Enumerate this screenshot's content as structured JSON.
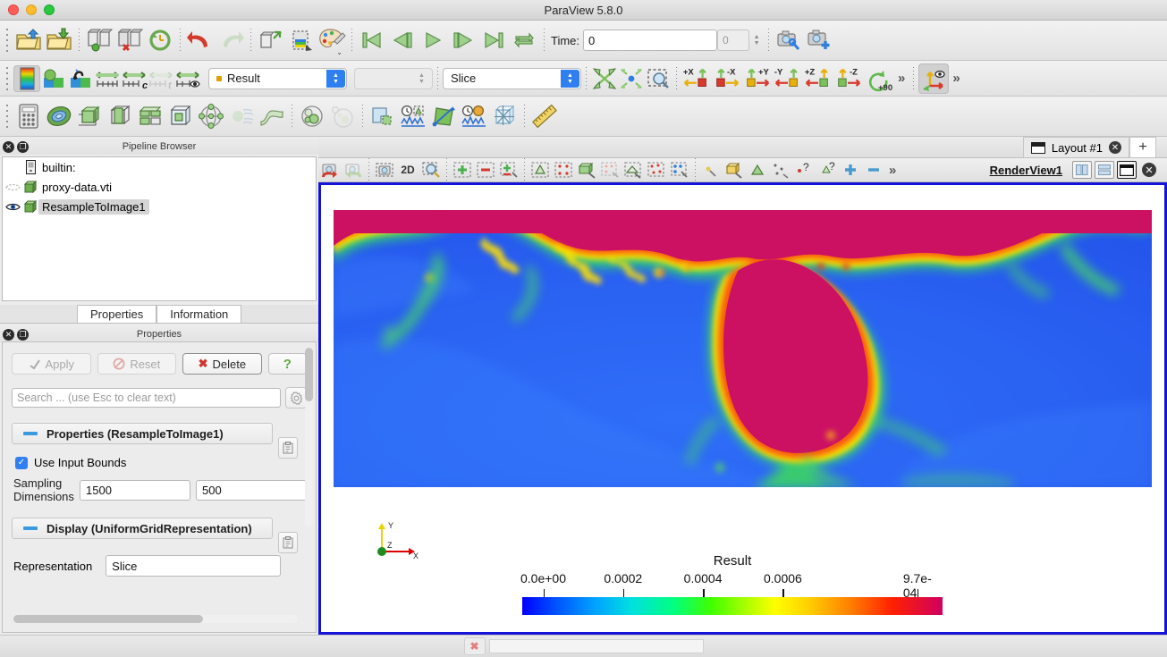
{
  "window": {
    "title": "ParaView 5.8.0",
    "traffic_lights": [
      "close-red",
      "minimize-yellow",
      "maximize-green"
    ]
  },
  "toolbars": {
    "row1": {
      "icons": [
        "open-file-icon",
        "save-state-icon",
        "connect-server-icon",
        "disconnect-server-icon",
        "reset-session-icon",
        "undo-icon",
        "redo-icon",
        "load-data-icon",
        "save-data-icon",
        "color-palette-icon"
      ],
      "vcr": [
        "first-frame-icon",
        "previous-frame-icon",
        "play-icon",
        "next-frame-icon",
        "last-frame-icon",
        "loop-icon"
      ],
      "time_label": "Time:",
      "time_value": "0",
      "frame_value": "0",
      "camera_icons": [
        "camera-link-icon",
        "camera-add-icon"
      ]
    },
    "row2": {
      "repr_icons": [
        "colormap-icon",
        "rescale-data-range-icon",
        "rescale-custom-icon",
        "rescale-visible-icon",
        "rescale-over-time-icon",
        "rescale-temporal-icon",
        "edit-color-legend-icon"
      ],
      "array_combo": "Result",
      "component_combo": "",
      "representation_combo": "Slice",
      "camera_buttons": [
        "reset-camera-icon",
        "zoom-to-data-icon",
        "zoom-to-box-icon"
      ],
      "axis_buttons": [
        "+X",
        "-X",
        "+Y",
        "-Y",
        "+Z",
        "-Z"
      ],
      "rotate_label": "+90",
      "overflow": "»",
      "center_axes_icon": "show-center-axes-icon"
    },
    "row3": {
      "icons": [
        "calculator-icon",
        "contour-icon",
        "clip-icon",
        "slice-icon",
        "threshold-icon",
        "extract-subset-icon",
        "glyph-icon",
        "stream-tracer-icon",
        "warp-icon",
        "group-datasets-icon",
        "extract-level-icon",
        "extract-block-icon",
        "plot-over-time-icon",
        "plot-over-line-icon",
        "probe-location-icon",
        "axes-grid-icon",
        "ruler-icon"
      ]
    }
  },
  "pipeline": {
    "panel_title": "Pipeline Browser",
    "items": [
      {
        "label": "builtin:",
        "icon": "server-icon",
        "eye": "none",
        "selected": false
      },
      {
        "label": "proxy-data.vti",
        "icon": "dataset-icon",
        "eye": "hidden",
        "selected": false
      },
      {
        "label": "ResampleToImage1",
        "icon": "dataset-icon",
        "eye": "visible",
        "selected": true
      }
    ]
  },
  "properties": {
    "tabs": [
      {
        "label": "Properties",
        "selected": true
      },
      {
        "label": "Information",
        "selected": false
      }
    ],
    "panel_title": "Properties",
    "buttons": [
      {
        "label": "Apply",
        "icon": "apply-icon",
        "enabled": false
      },
      {
        "label": "Reset",
        "icon": "reset-icon",
        "enabled": false
      },
      {
        "label": "Delete",
        "icon": "delete-icon",
        "enabled": true
      },
      {
        "label": "?",
        "icon": "help-icon",
        "enabled": true
      }
    ],
    "search_placeholder": "Search ... (use Esc to clear text)",
    "search_value": "",
    "gear_icon": "gear-icon",
    "sections": [
      {
        "title": "Properties (ResampleToImage1)",
        "collapse_icon": "collapse-minus-icon"
      },
      {
        "title": "Display (UniformGridRepresentation)",
        "collapse_icon": "collapse-minus-icon"
      }
    ],
    "use_input_bounds": {
      "label": "Use Input Bounds",
      "checked": true
    },
    "sampling": {
      "label_line1": "Sampling",
      "label_line2": "Dimensions",
      "values": [
        "1500",
        "500",
        ""
      ]
    },
    "representation": {
      "label": "Representation",
      "value": "Slice"
    }
  },
  "layout": {
    "tab_label": "Layout #1",
    "tab_icon": "layout-icon",
    "close_icon": "close-icon",
    "add_tab": "+"
  },
  "view": {
    "name": "RenderView1",
    "toolbar_icons": [
      "undo-camera-icon",
      "redo-camera-icon",
      "screenshot-icon",
      "2D",
      "zoom-select-icon",
      "add-selection-icon",
      "subtract-selection-icon",
      "toggle-selection-icon",
      "select-cells-icon",
      "select-points-icon",
      "select-surface-cells-icon",
      "select-surface-points-icon",
      "frustum-cells-icon",
      "frustum-points-icon",
      "block-select-icon",
      "interactive-select-points-icon",
      "hover-cells-icon",
      "hover-points-icon",
      "select-query-icon",
      "plus-icon",
      "minus-icon"
    ],
    "mode_2d_label": "2D",
    "split_buttons": [
      "split-horizontal-icon",
      "split-vertical-icon",
      "maximize-icon",
      "close-view-icon"
    ],
    "overflow": "»"
  },
  "legend": {
    "title": "Result",
    "tick_labels": [
      "0.0e+00",
      "0.0002",
      "0.0004",
      "0.0006",
      "9.7e-04"
    ],
    "tick_positions_pct": [
      5,
      24,
      43,
      62,
      94
    ],
    "mark_positions_pct": [
      5,
      24,
      43,
      62,
      94
    ],
    "colormap": "rainbow-jet"
  },
  "axes_widget": {
    "x_label": "X",
    "x_color": "#dd0000",
    "y_label": "Y",
    "y_color": "#e8d400",
    "z_label": "Z",
    "z_color": "#1f8b1f"
  },
  "statusbar": {
    "stop_icon": "stop-icon",
    "progress_value": ""
  },
  "chart_data": {
    "type": "heatmap",
    "title": "Result",
    "colorbar_min_label": "0.0e+00",
    "colorbar_max_label": "9.7e-04",
    "ticks": [
      "0.0e+00",
      "0.0002",
      "0.0004",
      "0.0006",
      "9.7e-04"
    ],
    "value_range": [
      0.0,
      0.00097
    ],
    "description": "Mandelbrot-style fractal slice rendered with a rainbow colormap; blue low field with magenta high-value interior set and yellow/green boundary filaments."
  }
}
